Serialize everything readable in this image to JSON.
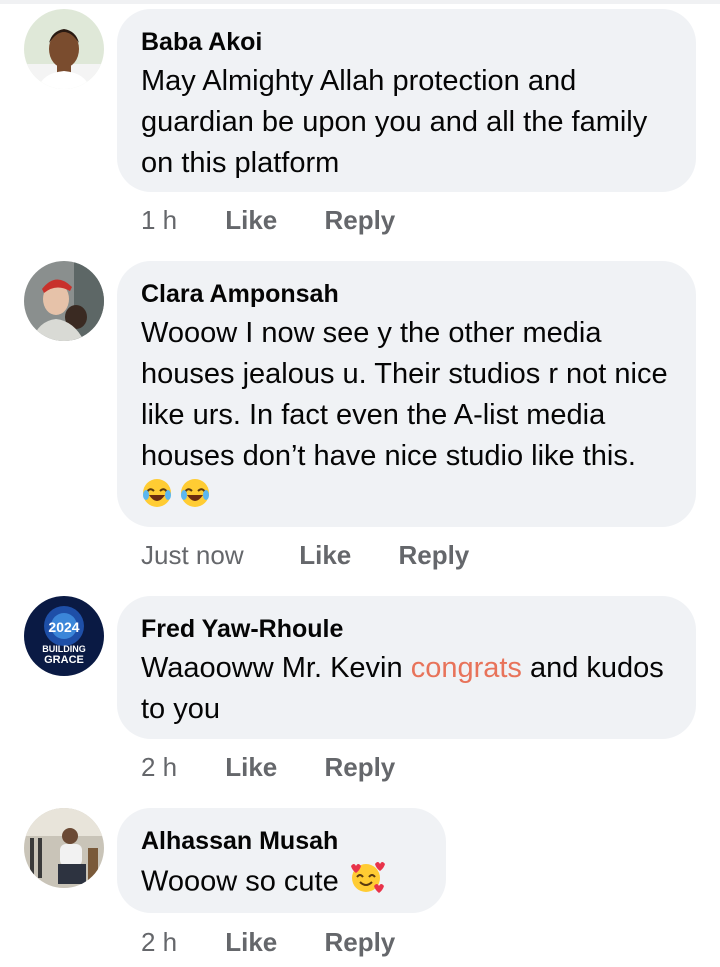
{
  "comments": [
    {
      "author": "Baba Akoi",
      "text": "May Almighty Allah protection and guardian be upon you and all the family on this platform",
      "time": "1 h",
      "like": "Like",
      "reply": "Reply"
    },
    {
      "author": "Clara Amponsah",
      "text": "Wooow I now see y the other media houses jealous u. Their studios r not nice like urs. In fact even the A-list media houses don’t have nice studio like this.",
      "time": "Just now",
      "like": "Like",
      "reply": "Reply"
    },
    {
      "author": "Fred Yaw-Rhoule",
      "text_before": "Waaooww Mr. Kevin ",
      "text_highlight": "congrats",
      "text_after": " and kudos to you",
      "avatar_text_line1": "BUILDING",
      "avatar_text_line2": "GRACE",
      "avatar_text_year": "2024",
      "time": "2 h",
      "like": "Like",
      "reply": "Reply"
    },
    {
      "author": "Alhassan Musah",
      "text": "Wooow so cute",
      "time": "2 h",
      "like": "Like",
      "reply": "Reply"
    }
  ],
  "colors": {
    "bubble": "#f0f2f5",
    "meta": "#65676b",
    "highlight": "#e8735a"
  },
  "icons": {
    "c2_emoji": "face-with-tears-of-joy",
    "c4_emoji": "smiling-face-with-hearts"
  }
}
